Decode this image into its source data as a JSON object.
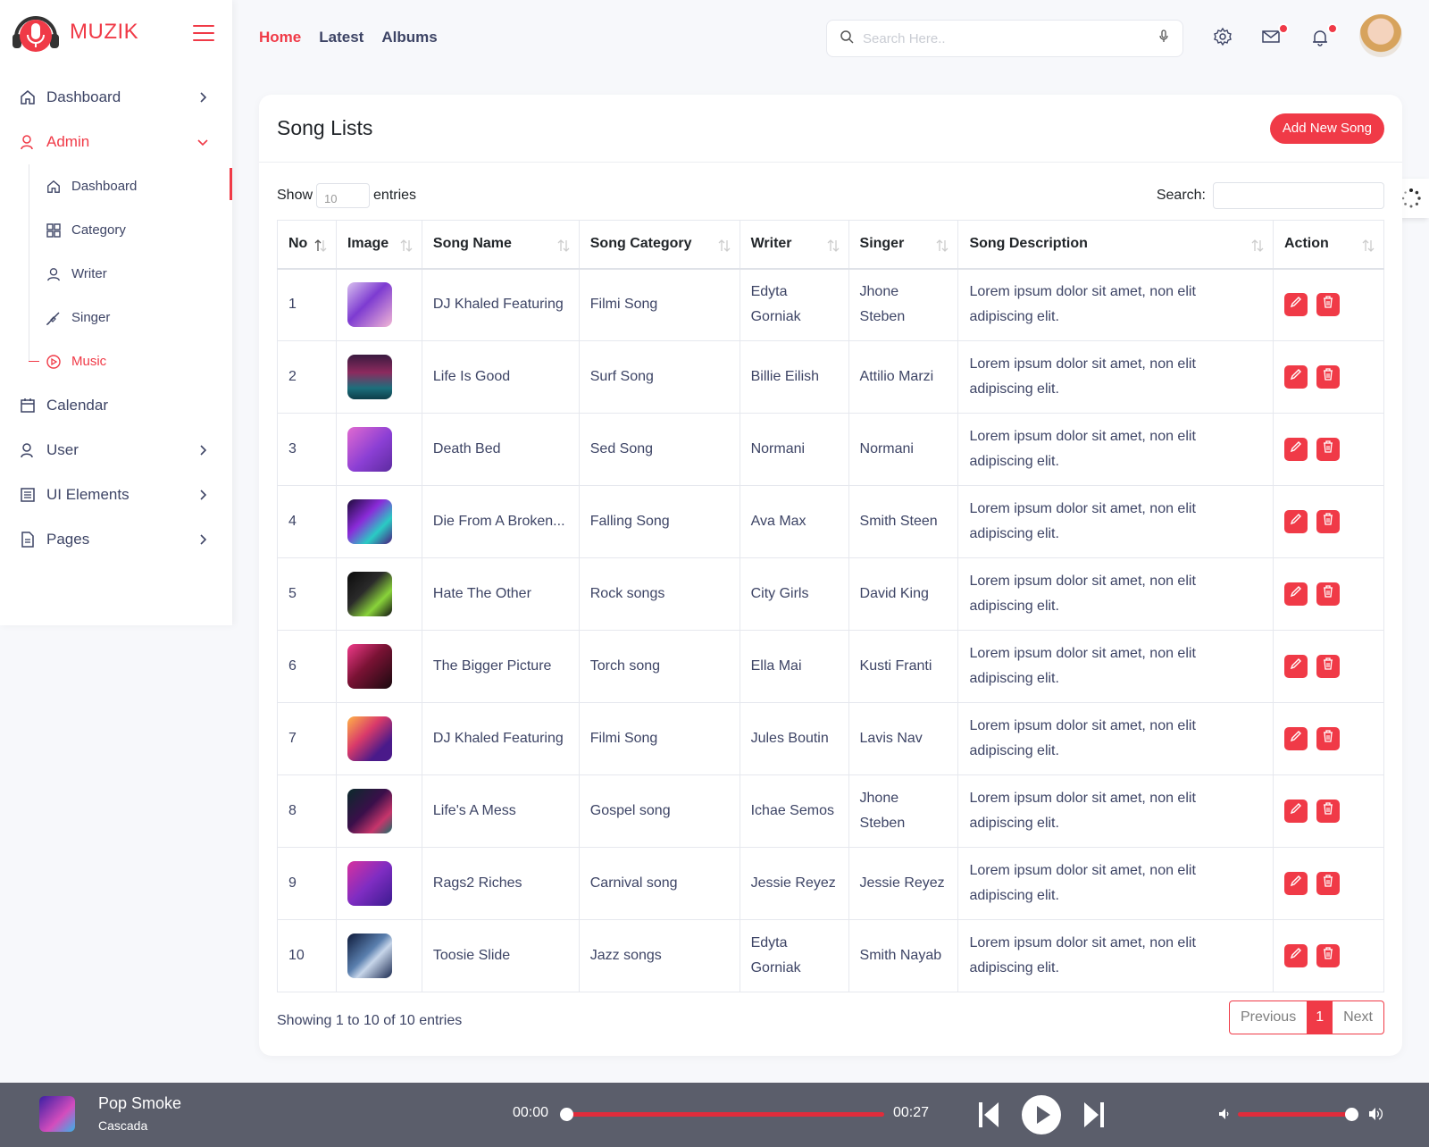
{
  "app": {
    "brand": "MUZIK"
  },
  "sidebar": {
    "items": [
      {
        "label": "Dashboard",
        "icon": "home-icon",
        "chevron": "right"
      },
      {
        "label": "Admin",
        "icon": "user-icon",
        "chevron": "down",
        "active": true
      },
      {
        "label": "Calendar",
        "icon": "calendar-icon"
      },
      {
        "label": "User",
        "icon": "user-icon",
        "chevron": "right"
      },
      {
        "label": "UI Elements",
        "icon": "list-icon",
        "chevron": "right"
      },
      {
        "label": "Pages",
        "icon": "file-icon",
        "chevron": "right"
      }
    ],
    "admin_sub": [
      {
        "label": "Dashboard",
        "icon": "home-icon"
      },
      {
        "label": "Category",
        "icon": "grid-icon"
      },
      {
        "label": "Writer",
        "icon": "user-icon"
      },
      {
        "label": "Singer",
        "icon": "brush-icon"
      },
      {
        "label": "Music",
        "icon": "play-circle-icon",
        "active": true
      }
    ]
  },
  "topnav": {
    "home": "Home",
    "latest": "Latest",
    "albums": "Albums"
  },
  "search": {
    "placeholder": "Search Here.."
  },
  "header": {
    "mail_badge": "",
    "bell_badge": ""
  },
  "card": {
    "title": "Song Lists",
    "add_button": "Add New Song",
    "show_label": "Show",
    "entries_label": "entries",
    "length_value": "10",
    "search_label": "Search:"
  },
  "table": {
    "columns": [
      "No",
      "Image",
      "Song Name",
      "Song Category",
      "Writer",
      "Singer",
      "Song Description",
      "Action"
    ],
    "rows": [
      {
        "no": "1",
        "name": "DJ Khaled Featuring",
        "category": "Filmi Song",
        "writer": "Edyta Gorniak",
        "singer": "Jhone Steben",
        "desc": "Lorem ipsum dolor sit amet, non elit adipiscing elit."
      },
      {
        "no": "2",
        "name": "Life Is Good",
        "category": "Surf Song",
        "writer": "Billie Eilish",
        "singer": "Attilio Marzi",
        "desc": "Lorem ipsum dolor sit amet, non elit adipiscing elit."
      },
      {
        "no": "3",
        "name": "Death Bed",
        "category": "Sed Song",
        "writer": "Normani",
        "singer": "Normani",
        "desc": "Lorem ipsum dolor sit amet, non elit adipiscing elit."
      },
      {
        "no": "4",
        "name": "Die From A Broken...",
        "category": "Falling Song",
        "writer": "Ava Max",
        "singer": "Smith Steen",
        "desc": "Lorem ipsum dolor sit amet, non elit adipiscing elit."
      },
      {
        "no": "5",
        "name": "Hate The Other",
        "category": "Rock songs",
        "writer": "City Girls",
        "singer": "David King",
        "desc": "Lorem ipsum dolor sit amet, non elit adipiscing elit."
      },
      {
        "no": "6",
        "name": "The Bigger Picture",
        "category": "Torch song",
        "writer": "Ella Mai",
        "singer": "Kusti Franti",
        "desc": "Lorem ipsum dolor sit amet, non elit adipiscing elit."
      },
      {
        "no": "7",
        "name": "DJ Khaled Featuring",
        "category": "Filmi Song",
        "writer": "Jules Boutin",
        "singer": "Lavis Nav",
        "desc": "Lorem ipsum dolor sit amet, non elit adipiscing elit."
      },
      {
        "no": "8",
        "name": "Life's A Mess",
        "category": "Gospel song",
        "writer": "Ichae Semos",
        "singer": "Jhone Steben",
        "desc": "Lorem ipsum dolor sit amet, non elit adipiscing elit."
      },
      {
        "no": "9",
        "name": "Rags2 Riches",
        "category": "Carnival song",
        "writer": "Jessie Reyez",
        "singer": "Jessie Reyez",
        "desc": "Lorem ipsum dolor sit amet, non elit adipiscing elit."
      },
      {
        "no": "10",
        "name": "Toosie Slide",
        "category": "Jazz songs",
        "writer": "Edyta Gorniak",
        "singer": "Smith Nayab",
        "desc": "Lorem ipsum dolor sit amet, non elit adipiscing elit."
      }
    ]
  },
  "footer": {
    "info": "Showing 1 to 10 of 10 entries",
    "previous": "Previous",
    "current_page": "1",
    "next": "Next"
  },
  "player": {
    "title": "Pop Smoke",
    "artist": "Cascada",
    "current_time": "00:00",
    "duration": "00:27",
    "progress": 0,
    "volume": 1.0
  },
  "colors": {
    "accent": "#f03a47",
    "player_bg": "#5b5e6b",
    "text": "#3d4465"
  }
}
